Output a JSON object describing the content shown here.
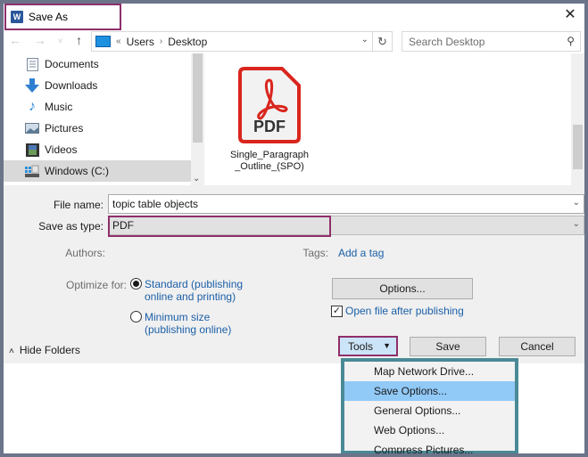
{
  "window": {
    "title": "Save As",
    "app_icon": "word-icon",
    "close_icon": "close-icon"
  },
  "navigation": {
    "back_icon": "back-arrow-icon",
    "forward_icon": "forward-arrow-icon",
    "recent_icon": "chevron-down-icon",
    "up_icon": "up-arrow-icon",
    "breadcrumb_prefix": "«",
    "breadcrumbs": [
      "Users",
      "Desktop"
    ],
    "breadcrumb_separator": "›",
    "search_placeholder": "Search Desktop"
  },
  "sidebar": {
    "items": [
      {
        "label": "Documents",
        "icon": "documents-icon",
        "selected": false
      },
      {
        "label": "Downloads",
        "icon": "downloads-icon",
        "selected": false
      },
      {
        "label": "Music",
        "icon": "music-icon",
        "selected": false
      },
      {
        "label": "Pictures",
        "icon": "pictures-icon",
        "selected": false
      },
      {
        "label": "Videos",
        "icon": "videos-icon",
        "selected": false
      },
      {
        "label": "Windows (C:)",
        "icon": "drive-icon",
        "selected": true
      }
    ]
  },
  "files": [
    {
      "name_line1": "Single_Paragraph",
      "name_line2": "_Outline_(SPO)",
      "type_label": "PDF"
    }
  ],
  "form": {
    "file_name_label": "File name:",
    "file_name_value": "topic table objects",
    "save_as_type_label": "Save as type:",
    "save_as_type_value": "PDF",
    "authors_label": "Authors:",
    "tags_label": "Tags:",
    "tags_link": "Add a tag",
    "optimize_label": "Optimize for:",
    "optimize_options": [
      {
        "line1": "Standard (publishing",
        "line2": "online and printing)",
        "selected": true
      },
      {
        "line1": "Minimum size",
        "line2": "(publishing online)",
        "selected": false
      }
    ],
    "options_button": "Options...",
    "open_after_label": "Open file after publishing",
    "open_after_checked": true
  },
  "footer": {
    "hide_folders": "Hide Folders",
    "tools_button": "Tools",
    "save_button": "Save",
    "cancel_button": "Cancel"
  },
  "tools_menu": {
    "items": [
      {
        "label": "Map Network Drive...",
        "highlighted": false
      },
      {
        "label": "Save Options...",
        "highlighted": true
      },
      {
        "label": "General Options...",
        "highlighted": false
      },
      {
        "label": "Web Options...",
        "highlighted": false
      },
      {
        "label": "Compress Pictures...",
        "highlighted": false
      }
    ]
  },
  "colors": {
    "highlight_border": "#8e2f6b",
    "menu_border": "#4a8a96",
    "menu_highlight": "#91c9f7",
    "link": "#1c5fa8",
    "pdf_red": "#d9251d"
  }
}
